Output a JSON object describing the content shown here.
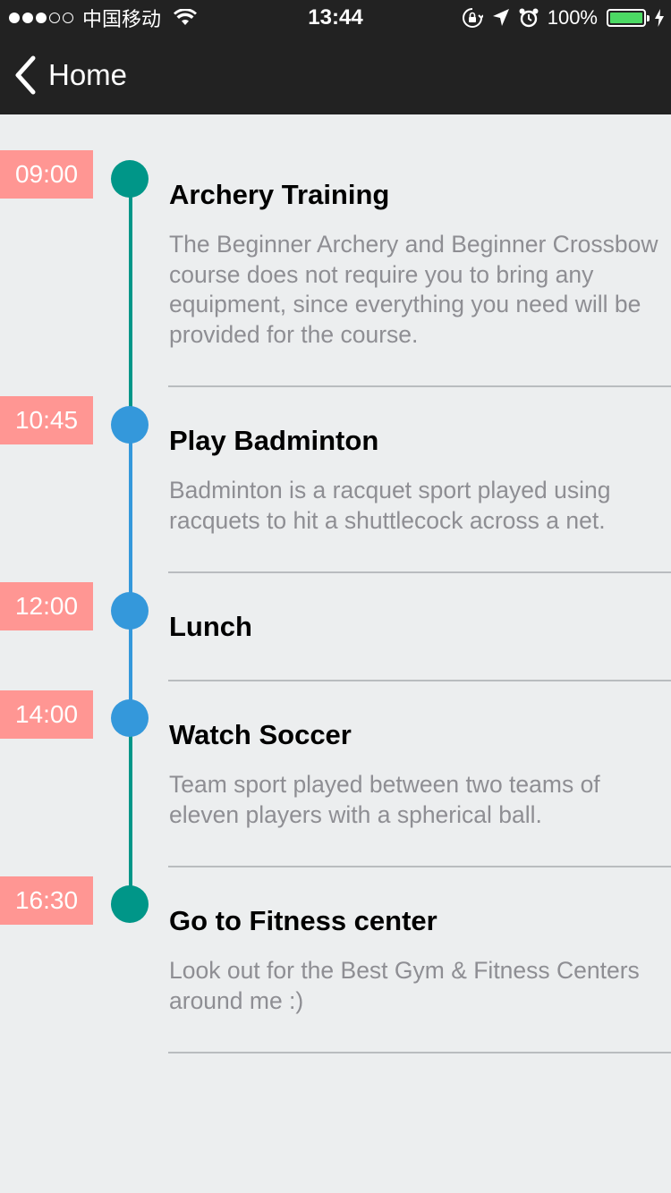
{
  "status_bar": {
    "carrier": "中国移动",
    "time": "13:44",
    "battery_percent": "100%",
    "signal_bars_filled": 3,
    "signal_bars_total": 5
  },
  "nav": {
    "back_label": "Home"
  },
  "colors": {
    "timeline_green": "#009688",
    "timeline_blue": "#3498DB",
    "time_badge": "#FF9693",
    "background": "#ECEEEF",
    "bar": "#222222"
  },
  "events": [
    {
      "time": "09:00",
      "title": "Archery Training",
      "description": "The Beginner Archery and Beginner Crossbow course does not require you to bring any equipment, since everything you need will be provided for the course.",
      "dot_color": "#009688",
      "line_color": "#009688"
    },
    {
      "time": "10:45",
      "title": "Play Badminton",
      "description": "Badminton is a racquet sport played using racquets to hit a shuttlecock across a net.",
      "dot_color": "#3498DB",
      "line_color": "#3498DB"
    },
    {
      "time": "12:00",
      "title": "Lunch",
      "description": "",
      "dot_color": "#3498DB",
      "line_color": "#3498DB"
    },
    {
      "time": "14:00",
      "title": "Watch Soccer",
      "description": "Team sport played between two teams of eleven players with a spherical ball.",
      "dot_color": "#3498DB",
      "line_color": "#009688"
    },
    {
      "time": "16:30",
      "title": "Go to Fitness center",
      "description": "Look out for the Best Gym & Fitness Centers around me :)",
      "dot_color": "#009688",
      "line_color": ""
    }
  ]
}
